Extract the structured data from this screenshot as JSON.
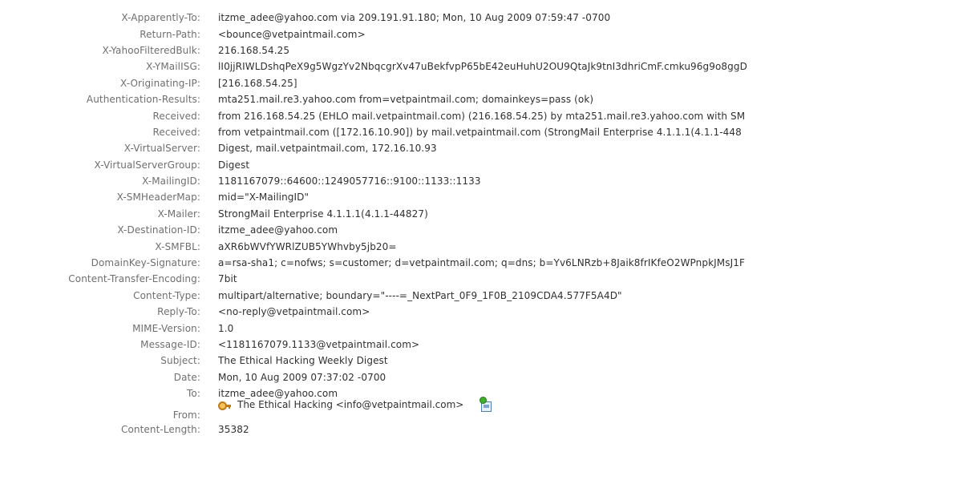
{
  "headers": [
    {
      "name": "X-Apparently-To:",
      "value": "itzme_adee@yahoo.com via 209.191.91.180; Mon, 10 Aug 2009 07:59:47 -0700"
    },
    {
      "name": "Return-Path:",
      "value": "<bounce@vetpaintmail.com>"
    },
    {
      "name": "X-YahooFilteredBulk:",
      "value": "216.168.54.25"
    },
    {
      "name": "X-YMailISG:",
      "value": "lI0jjRIWLDshqPeX9g5WgzYv2NbqcgrXv47uBekfvpP65bE42euHuhU2OU9QtaJk9tnI3dhriCmF.cmku96g9o8ggD"
    },
    {
      "name": "X-Originating-IP:",
      "value": "[216.168.54.25]"
    },
    {
      "name": "Authentication-Results:",
      "value": "mta251.mail.re3.yahoo.com from=vetpaintmail.com; domainkeys=pass (ok)"
    },
    {
      "name": "Received:",
      "value": "from 216.168.54.25 (EHLO mail.vetpaintmail.com) (216.168.54.25) by mta251.mail.re3.yahoo.com with SM"
    },
    {
      "name": "Received:",
      "value": "from vetpaintmail.com ([172.16.10.90]) by mail.vetpaintmail.com (StrongMail Enterprise 4.1.1.1(4.1.1-448"
    },
    {
      "name": "X-VirtualServer:",
      "value": "Digest, mail.vetpaintmail.com, 172.16.10.93"
    },
    {
      "name": "X-VirtualServerGroup:",
      "value": "Digest"
    },
    {
      "name": "X-MailingID:",
      "value": "1181167079::64600::1249057716::9100::1133::1133"
    },
    {
      "name": "X-SMHeaderMap:",
      "value": "mid=\"X-MailingID\""
    },
    {
      "name": "X-Mailer:",
      "value": "StrongMail Enterprise 4.1.1.1(4.1.1-44827)"
    },
    {
      "name": "X-Destination-ID:",
      "value": "itzme_adee@yahoo.com"
    },
    {
      "name": "X-SMFBL:",
      "value": "aXR6bWVfYWRlZUB5YWhvby5jb20="
    },
    {
      "name": "DomainKey-Signature:",
      "value": "a=rsa-sha1; c=nofws; s=customer; d=vetpaintmail.com; q=dns; b=Yv6LNRzb+8Jaik8frIKfeO2WPnpkJMsJ1F"
    },
    {
      "name": "Content-Transfer-Encoding:",
      "value": "7bit"
    },
    {
      "name": "Content-Type:",
      "value": "multipart/alternative; boundary=\"----=_NextPart_0F9_1F0B_2109CDA4.577F5A4D\""
    },
    {
      "name": "Reply-To:",
      "value": "<no-reply@vetpaintmail.com>"
    },
    {
      "name": "MIME-Version:",
      "value": "1.0"
    },
    {
      "name": "Message-ID:",
      "value": "<1181167079.1133@vetpaintmail.com>"
    },
    {
      "name": "Subject:",
      "value": "The Ethical Hacking Weekly Digest"
    },
    {
      "name": "Date:",
      "value": "Mon, 10 Aug 2009 07:37:02 -0700"
    },
    {
      "name": "To:",
      "value": "itzme_adee@yahoo.com"
    }
  ],
  "from": {
    "name": "From:",
    "value": "The Ethical Hacking <info@vetpaintmail.com>",
    "sender_icon": "key-icon",
    "contact_icon": "add-contact-icon"
  },
  "content_length": {
    "name": "Content-Length:",
    "value": "35382"
  }
}
